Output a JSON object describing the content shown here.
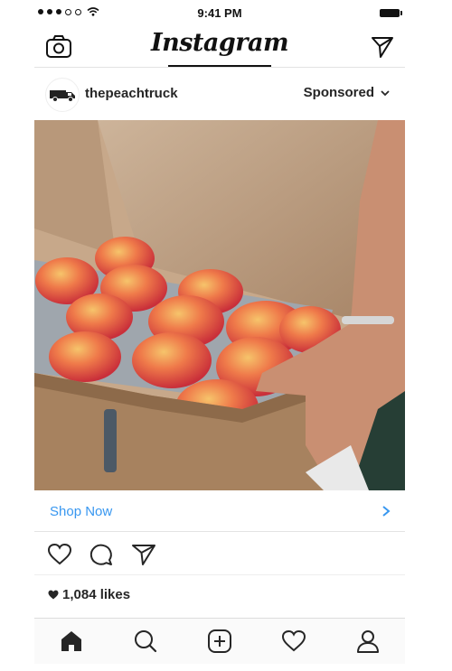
{
  "status_bar": {
    "time": "9:41 PM"
  },
  "nav": {
    "brand": "Instagram"
  },
  "post": {
    "username": "thepeachtruck",
    "sponsored_label": "Sponsored",
    "cta_label": "Shop Now",
    "likes_label": "1,084 likes"
  },
  "colors": {
    "link": "#3897f0",
    "text": "#262626"
  },
  "icons": [
    "camera-icon",
    "direct-message-icon",
    "truck-logo-icon",
    "chevron-down-icon",
    "chevron-right-icon",
    "heart-icon",
    "comment-icon",
    "share-icon",
    "home-icon",
    "search-icon",
    "add-post-icon",
    "activity-heart-icon",
    "profile-icon"
  ]
}
